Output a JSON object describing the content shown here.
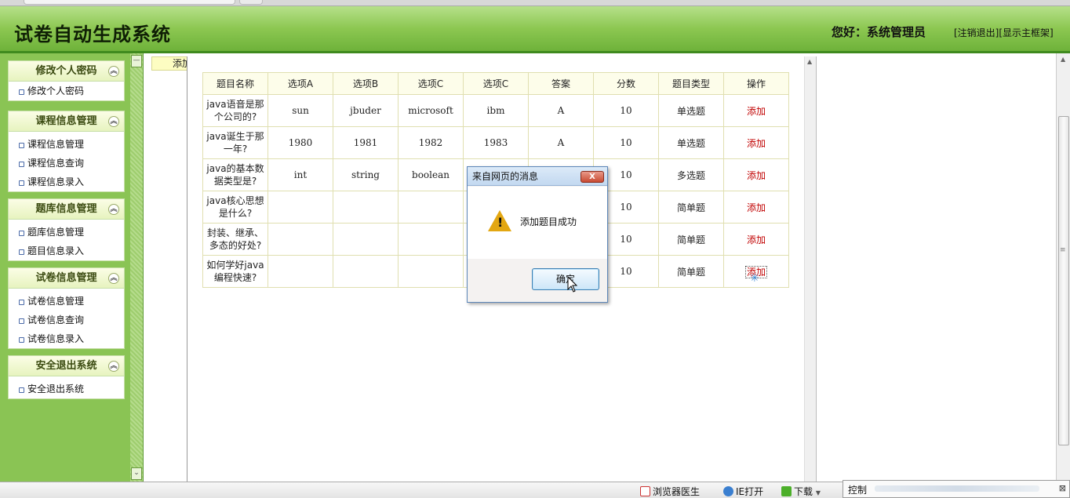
{
  "app": {
    "title": "试卷自动生成系统",
    "greeting": "您好：系统管理员",
    "links": [
      "[注销退出]",
      "[显示主框架]"
    ]
  },
  "sidebar": {
    "sections": [
      {
        "title": "修改个人密码",
        "items": [
          "修改个人密码"
        ]
      },
      {
        "title": "课程信息管理",
        "items": [
          "课程信息管理",
          "课程信息查询",
          "课程信息录入"
        ]
      },
      {
        "title": "题库信息管理",
        "items": [
          "题库信息管理",
          "题目信息录入"
        ]
      },
      {
        "title": "试卷信息管理",
        "items": [
          "试卷信息管理",
          "试卷信息查询",
          "试卷信息录入"
        ]
      },
      {
        "title": "安全退出系统",
        "items": [
          "安全退出系统"
        ]
      }
    ],
    "collapse_icon": "double-chevron-up-icon"
  },
  "content": {
    "tab_label": "添加",
    "table": {
      "headers": [
        "题目名称",
        "选项A",
        "选项B",
        "选项C",
        "选项C",
        "答案",
        "分数",
        "题目类型",
        "操作"
      ],
      "rows": [
        {
          "name": "java语音是那个公司的?",
          "a": "sun",
          "b": "jbuder",
          "c": "microsoft",
          "d": "ibm",
          "answer": "A",
          "score": "10",
          "type": "单选题",
          "op": "添加"
        },
        {
          "name": "java诞生于那一年?",
          "a": "1980",
          "b": "1981",
          "c": "1982",
          "d": "1983",
          "answer": "A",
          "score": "10",
          "type": "单选题",
          "op": "添加"
        },
        {
          "name": "java的基本数据类型是?",
          "a": "int",
          "b": "string",
          "c": "boolean",
          "d": "",
          "answer": "",
          "score": "10",
          "type": "多选题",
          "op": "添加"
        },
        {
          "name": "java核心思想是什么?",
          "a": "",
          "b": "",
          "c": "",
          "d": "",
          "answer": "",
          "score": "10",
          "type": "简单题",
          "op": "添加"
        },
        {
          "name": "封装、继承、多态的好处?",
          "a": "",
          "b": "",
          "c": "",
          "d": "",
          "answer": "",
          "score": "10",
          "type": "简单题",
          "op": "添加"
        },
        {
          "name": "如何学好java编程快速?",
          "a": "",
          "b": "",
          "c": "",
          "d": "",
          "answer": "",
          "score": "10",
          "type": "简单题",
          "op": "添加"
        }
      ]
    }
  },
  "dialog": {
    "title": "来自网页的消息",
    "message": "添加题目成功",
    "ok_label": "确定",
    "close_label": "X",
    "icon": "warning-icon"
  },
  "statusbar": {
    "items": [
      "浏览器医生",
      "IE打开",
      "下载"
    ],
    "control_label": "控制"
  },
  "colors": {
    "header_green": "#8cc751",
    "sidebar_green": "#8ac454",
    "action_red": "#c00000"
  }
}
